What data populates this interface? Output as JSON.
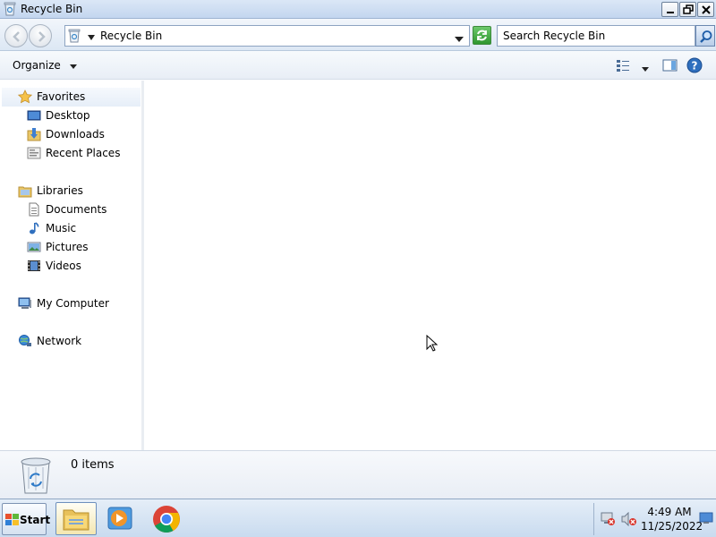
{
  "window": {
    "title": "Recycle Bin",
    "icon": "recycle-bin-icon",
    "controls": [
      "minimize-icon",
      "restore-icon",
      "close-icon"
    ]
  },
  "address": {
    "location": "Recycle Bin",
    "search_placeholder": "Search Recycle Bin"
  },
  "commandbar": {
    "organize_label": "Organize"
  },
  "navpane": {
    "favorites": {
      "label": "Favorites",
      "items": [
        {
          "label": "Desktop",
          "icon": "desktop-icon"
        },
        {
          "label": "Downloads",
          "icon": "downloads-icon"
        },
        {
          "label": "Recent Places",
          "icon": "recent-places-icon"
        }
      ]
    },
    "libraries": {
      "label": "Libraries",
      "items": [
        {
          "label": "Documents",
          "icon": "documents-icon"
        },
        {
          "label": "Music",
          "icon": "music-icon"
        },
        {
          "label": "Pictures",
          "icon": "pictures-icon"
        },
        {
          "label": "Videos",
          "icon": "videos-icon"
        }
      ]
    },
    "computer": {
      "label": "My Computer"
    },
    "network": {
      "label": "Network"
    }
  },
  "details": {
    "item_count": "0 items"
  },
  "taskbar": {
    "start_label": "Start",
    "apps": [
      "windows-explorer-icon",
      "media-player-icon",
      "chrome-icon"
    ],
    "clock_time": "4:49 AM",
    "clock_date": "11/25/2022"
  },
  "colors": {
    "titlebar": "#c3d6ef",
    "taskbar": "#c9dbef",
    "refresh_green": "#2e962e"
  }
}
